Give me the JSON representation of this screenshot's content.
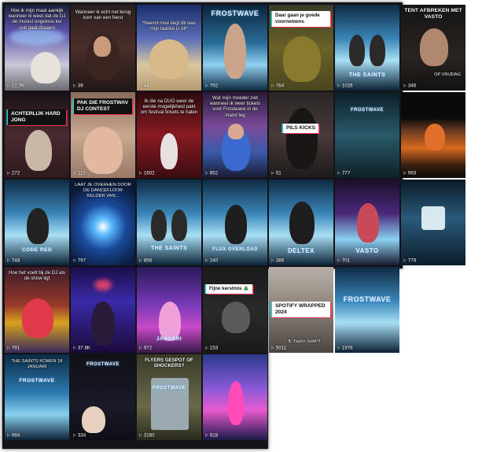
{
  "videos": [
    {
      "views": "12.7K",
      "caption": "Hoe ik mijn maat aankijk wanneer ik weet dat de DJ de mooist ongeloos kei ooit gaat draaien",
      "sticker": "",
      "brand": ""
    },
    {
      "views": "39",
      "caption": "Wanneer ik echt net terug kom van een feest",
      "sticker": "",
      "brand": ""
    },
    {
      "views": "44",
      "caption": "*Neemt mee liegt dit was mijn laatste is dit*",
      "sticker": "",
      "brand": ""
    },
    {
      "views": "792",
      "caption": "",
      "sticker": "",
      "brand": "FROSTWAVE"
    },
    {
      "views": "764",
      "caption": "",
      "sticker": "Daar gaan je goede voornemens",
      "brand": ""
    },
    {
      "views": "1026",
      "caption": "",
      "sticker": "",
      "brand": "THE SAINTS"
    },
    {
      "views": "346",
      "caption": "TENT AFBREKEN MET VASTO",
      "sticker": "",
      "brand": "OP VRIJDAG"
    },
    {
      "views": "272",
      "caption": "",
      "sticker": "ACHTERLIJK HARD JONG",
      "brand": ""
    },
    {
      "views": "110",
      "caption": "",
      "sticker": "PAK DIE FROSTWAV DJ CONTEST",
      "brand": ""
    },
    {
      "views": "1602",
      "caption": "Ik die na DUO weer de eerste mogelijkheid pakt om festival tickets te halen",
      "sticker": "",
      "brand": ""
    },
    {
      "views": "852",
      "caption": "Wat mijn moeder ziet wanneer ik weer tickets voor Frostwave in de mand leg",
      "sticker": "",
      "brand": ""
    },
    {
      "views": "51",
      "caption": "",
      "sticker": "PILS KICKS",
      "brand": ""
    },
    {
      "views": "777",
      "caption": "",
      "sticker": "",
      "brand": "FROSTWAVE"
    },
    {
      "views": "993",
      "caption": "",
      "sticker": "",
      "brand": ""
    },
    {
      "views": "748",
      "caption": "",
      "sticker": "",
      "brand": "CODE RED"
    },
    {
      "views": "797",
      "caption": "LAAT JE OVERHEN DOOR DE DANCEFLOOR KELDER VAN...",
      "sticker": "",
      "brand": ""
    },
    {
      "views": "856",
      "caption": "",
      "sticker": "",
      "brand": "THE SAINTS"
    },
    {
      "views": "240",
      "caption": "",
      "sticker": "",
      "brand": "FLUX OVERLOAD"
    },
    {
      "views": "386",
      "caption": "",
      "sticker": "",
      "brand": "DELTEX"
    },
    {
      "views": "701",
      "caption": "",
      "sticker": "",
      "brand": "VASTO"
    },
    {
      "views": "779",
      "caption": "",
      "sticker": "",
      "brand": ""
    },
    {
      "views": "791",
      "caption": "Hoe het voelt bij de DJ als de show ligt",
      "sticker": "",
      "brand": ""
    },
    {
      "views": "37.8K",
      "caption": "",
      "sticker": "",
      "brand": ""
    },
    {
      "views": "972",
      "caption": "",
      "sticker": "",
      "brand": "JANUARI"
    },
    {
      "views": "153",
      "caption": "",
      "sticker": "Fijne kerstmis 🎄",
      "brand": ""
    },
    {
      "views": "5011",
      "caption": "ft. Taylor Swift?!",
      "sticker": "SPOTIFY WRAPPED 2024",
      "brand": ""
    },
    {
      "views": "1978",
      "caption": "",
      "sticker": "",
      "brand": "FROSTWAVE"
    },
    {
      "views": "984",
      "caption": "THE SAINTS KOMEN 18 JANUARI",
      "sticker": "",
      "brand": "FROSTWAVE"
    },
    {
      "views": "334",
      "caption": "",
      "sticker": "",
      "brand": "FROSTWAVE"
    },
    {
      "views": "3160",
      "caption": "FLYERS GESPOT OF SHOCKERS?",
      "sticker": "",
      "brand": "FROSTWAVE"
    },
    {
      "views": "918",
      "caption": "",
      "sticker": "",
      "brand": ""
    }
  ],
  "theme": {
    "sticker_cyan": "#1fd3e0",
    "sticker_pink": "#f0335a",
    "icon": "play-icon"
  }
}
